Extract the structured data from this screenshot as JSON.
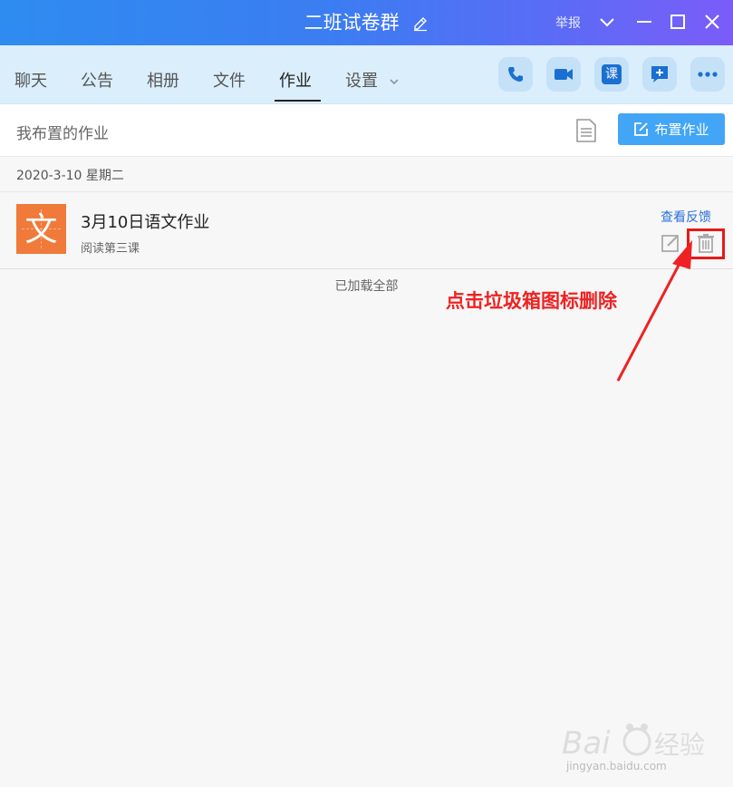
{
  "window": {
    "title": "二班试卷群",
    "report_label": "举报"
  },
  "tabs": [
    {
      "label": "聊天"
    },
    {
      "label": "公告"
    },
    {
      "label": "相册"
    },
    {
      "label": "文件"
    },
    {
      "label": "作业"
    },
    {
      "label": "设置"
    }
  ],
  "nav_buttons": [
    "phone-icon",
    "video-call-icon",
    "course-icon",
    "add-chat-icon",
    "more-icon"
  ],
  "nav_course_label": "课",
  "toolbar": {
    "label": "我布置的作业",
    "assign_label": "布置作业"
  },
  "homework": {
    "date": "2020-3-10 星期二",
    "items": [
      {
        "subject_char": "文",
        "title": "3月10日语文作业",
        "subtitle": "阅读第三课",
        "feedback_label": "查看反馈"
      }
    ],
    "loaded_label": "已加载全部"
  },
  "annotation": {
    "text": "点击垃圾箱图标删除",
    "color": "#ee2222"
  },
  "watermark": {
    "text": "jingyan.baidu.com"
  },
  "colors": {
    "accent": "#42a5f5",
    "title_gradient_start": "#2e8cf0",
    "title_gradient_end": "#7b5cf8",
    "subject_bg": "#f07a3a"
  }
}
